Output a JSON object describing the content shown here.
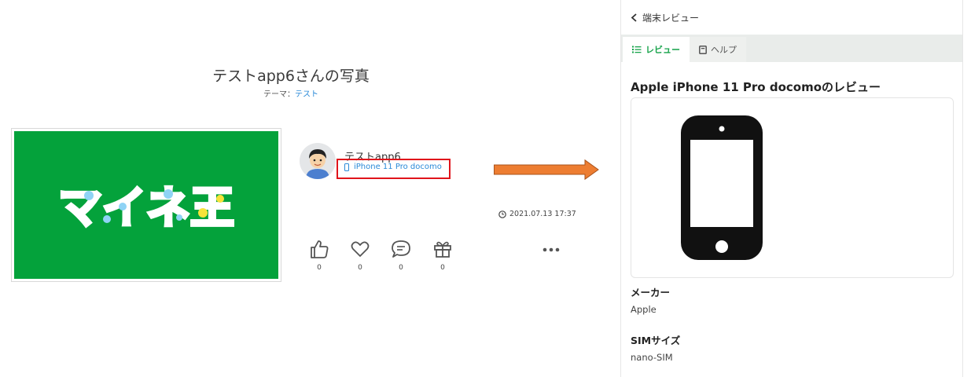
{
  "left": {
    "photo_title": "テストapp6さんの写真",
    "theme_label": "テーマ：",
    "theme_value": "テスト",
    "photo_logo": "マイネ王",
    "user_name": "テストapp6",
    "device_name": "iPhone 11 Pro docomo",
    "timestamp": "2021.07.13 17:37",
    "actions": [
      {
        "icon": "thumbs-up-icon",
        "count": "0"
      },
      {
        "icon": "heart-icon",
        "count": "0"
      },
      {
        "icon": "comment-icon",
        "count": "0"
      },
      {
        "icon": "gift-icon",
        "count": "0"
      }
    ],
    "more_icon": "more-dots-icon"
  },
  "right": {
    "back_label": "端末レビュー",
    "tabs": [
      {
        "label": "レビュー",
        "icon": "list-icon",
        "active": true
      },
      {
        "label": "ヘルプ",
        "icon": "help-book-icon",
        "active": false
      }
    ],
    "review_title": "Apple iPhone 11 Pro docomoのレビュー",
    "specs": [
      {
        "label": "メーカー",
        "value": "Apple"
      },
      {
        "label": "SIMサイズ",
        "value": "nano-SIM"
      }
    ]
  },
  "colors": {
    "accent_green": "#16a34a",
    "photo_green": "#04a23b",
    "link_blue": "#2a8ad8",
    "highlight_red": "#e0141b",
    "arrow_orange": "#ed7d31"
  }
}
